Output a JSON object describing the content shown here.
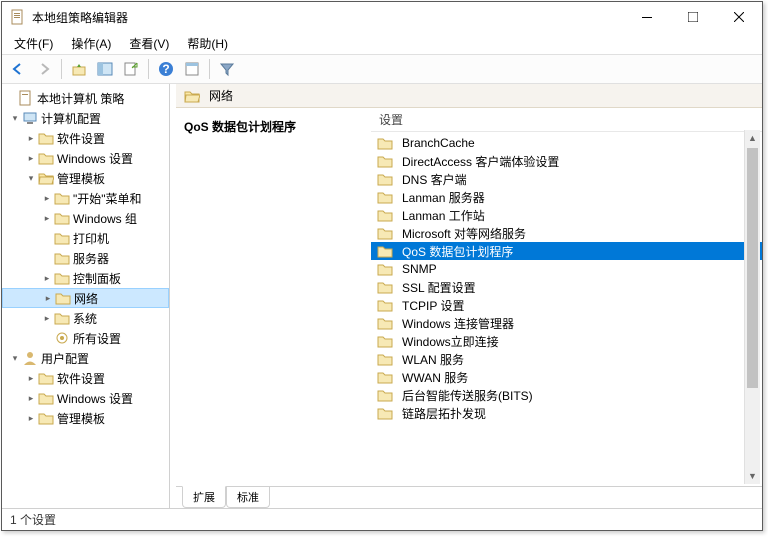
{
  "window": {
    "title": "本地组策略编辑器"
  },
  "menu": {
    "file": "文件(F)",
    "action": "操作(A)",
    "view": "查看(V)",
    "help": "帮助(H)"
  },
  "tree": {
    "root": "本地计算机 策略",
    "computer": "计算机配置",
    "c_soft": "软件设置",
    "c_win": "Windows 设置",
    "c_admin": "管理模板",
    "c_start": "\"开始\"菜单和",
    "c_wincomp": "Windows 组",
    "c_printer": "打印机",
    "c_server": "服务器",
    "c_ctrl": "控制面板",
    "c_net": "网络",
    "c_sys": "系统",
    "c_all": "所有设置",
    "user": "用户配置",
    "u_soft": "软件设置",
    "u_win": "Windows 设置",
    "u_admin": "管理模板"
  },
  "path": {
    "label": "网络"
  },
  "detail": {
    "heading": "QoS 数据包计划程序",
    "col_setting": "设置"
  },
  "items": [
    "BranchCache",
    "DirectAccess 客户端体验设置",
    "DNS 客户端",
    "Lanman 服务器",
    "Lanman 工作站",
    "Microsoft 对等网络服务",
    "QoS 数据包计划程序",
    "SNMP",
    "SSL 配置设置",
    "TCPIP 设置",
    "Windows 连接管理器",
    "Windows立即连接",
    "WLAN 服务",
    "WWAN 服务",
    "后台智能传送服务(BITS)",
    "链路层拓扑发现"
  ],
  "selected_index": 6,
  "tabs": {
    "ext": "扩展",
    "std": "标准"
  },
  "status": {
    "text": "1 个设置"
  }
}
